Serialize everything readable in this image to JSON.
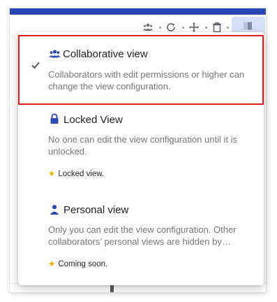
{
  "menu": {
    "items": [
      {
        "title": "Collaborative view",
        "description": "Collaborators with edit permissions or higher can change the view configuration.",
        "icon": "people-icon",
        "selected": true
      },
      {
        "title": "Locked View",
        "description": "No one can edit the view configuration until it is unlocked.",
        "icon": "lock-icon",
        "note": "Locked view."
      },
      {
        "title": "Personal view",
        "description": "Only you can edit the view configuration. Other collaborators’ personal views are hidden by…",
        "icon": "person-icon",
        "note": "Coming soon."
      }
    ]
  },
  "colors": {
    "accent": "#2a4ab8",
    "header_bar": "#2747b3",
    "selection_outline": "#e01e1e",
    "star": "#f0b400",
    "active_tool": "#d8e2f7"
  }
}
